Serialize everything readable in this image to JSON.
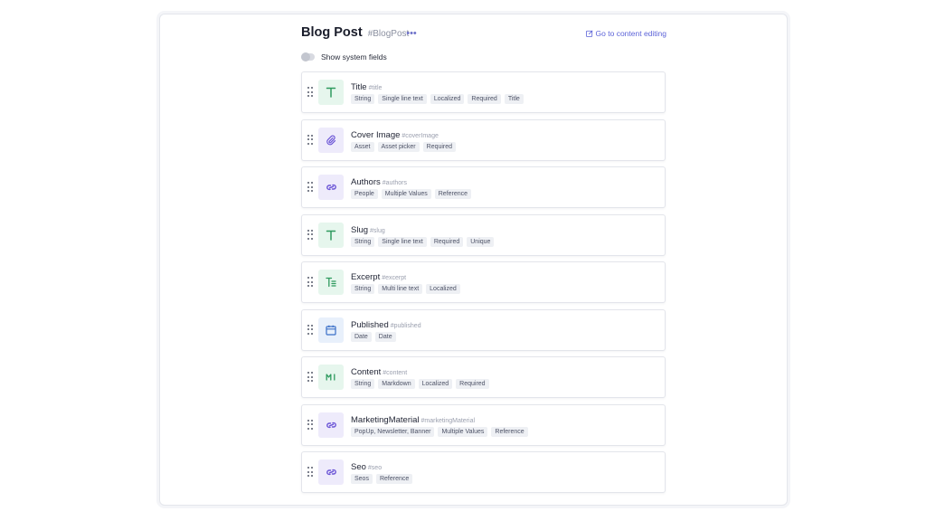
{
  "header": {
    "title": "Blog Post",
    "api_id": "#BlogPost",
    "more_label": "•••",
    "goto_label": "Go to content editing"
  },
  "system_fields": {
    "label": "Show system fields",
    "enabled": false
  },
  "colors": {
    "accent": "#5c63d8",
    "string_icon_bg": "#e6f6ed",
    "string_icon_fg": "#2e9a5e",
    "link_icon_bg": "#eeebfb",
    "link_icon_fg": "#6b55d6",
    "date_icon_bg": "#e8f0fb",
    "date_icon_fg": "#3a6fc8"
  },
  "fields": [
    {
      "name": "Title",
      "api": "#title",
      "icon": "text-icon",
      "tags": [
        "String",
        "Single line text",
        "Localized",
        "Required",
        "Title"
      ]
    },
    {
      "name": "Cover Image",
      "api": "#coverImage",
      "icon": "paperclip-icon",
      "tags": [
        "Asset",
        "Asset picker",
        "Required"
      ]
    },
    {
      "name": "Authors",
      "api": "#authors",
      "icon": "link-icon",
      "tags": [
        "People",
        "Multiple Values",
        "Reference"
      ]
    },
    {
      "name": "Slug",
      "api": "#slug",
      "icon": "text-icon",
      "tags": [
        "String",
        "Single line text",
        "Required",
        "Unique"
      ]
    },
    {
      "name": "Excerpt",
      "api": "#excerpt",
      "icon": "multiline-text-icon",
      "tags": [
        "String",
        "Multi line text",
        "Localized"
      ]
    },
    {
      "name": "Published",
      "api": "#published",
      "icon": "calendar-icon",
      "tags": [
        "Date",
        "Date"
      ]
    },
    {
      "name": "Content",
      "api": "#content",
      "icon": "markdown-icon",
      "tags": [
        "String",
        "Markdown",
        "Localized",
        "Required"
      ]
    },
    {
      "name": "MarketingMaterial",
      "api": "#marketingMaterial",
      "icon": "link-icon",
      "tags": [
        "PopUp, Newsletter, Banner",
        "Multiple Values",
        "Reference"
      ]
    },
    {
      "name": "Seo",
      "api": "#seo",
      "icon": "link-icon",
      "tags": [
        "Seos",
        "Reference"
      ]
    }
  ]
}
